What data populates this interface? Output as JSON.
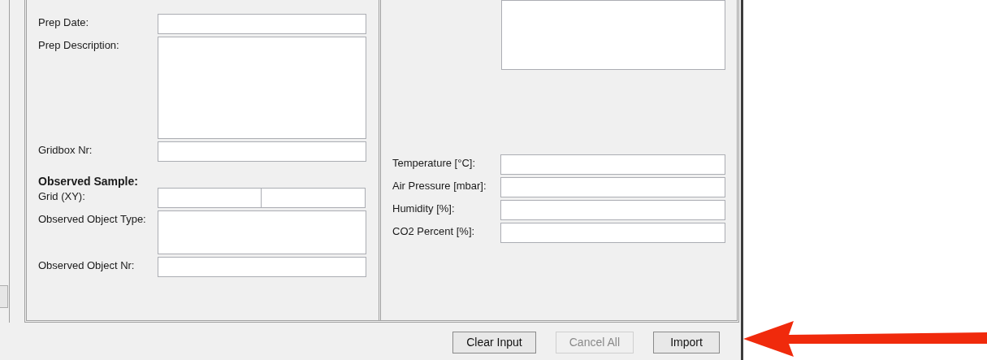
{
  "preparation": {
    "fields": [
      {
        "label": "Prep Date:",
        "kind": "line"
      },
      {
        "label": "Prep Description:",
        "kind": "area"
      },
      {
        "label": "Gridbox Nr:",
        "kind": "line"
      }
    ]
  },
  "observed_sample": {
    "heading": "Observed Sample:",
    "fields": [
      {
        "label": "Grid (XY):",
        "kind": "pair"
      },
      {
        "label": "Observed Object Type:",
        "kind": "short_area"
      },
      {
        "label": "Observed Object Nr:",
        "kind": "line"
      }
    ]
  },
  "conditions": {
    "fields": [
      {
        "label": "Temperature [°C]:"
      },
      {
        "label": "Air Pressure [mbar]:"
      },
      {
        "label": "Humidity [%]:"
      },
      {
        "label": "CO2 Percent [%]:"
      }
    ]
  },
  "buttons": [
    {
      "label": "Clear Input",
      "disabled": false
    },
    {
      "label": "Cancel All",
      "disabled": true
    },
    {
      "label": "Import",
      "disabled": false
    }
  ]
}
